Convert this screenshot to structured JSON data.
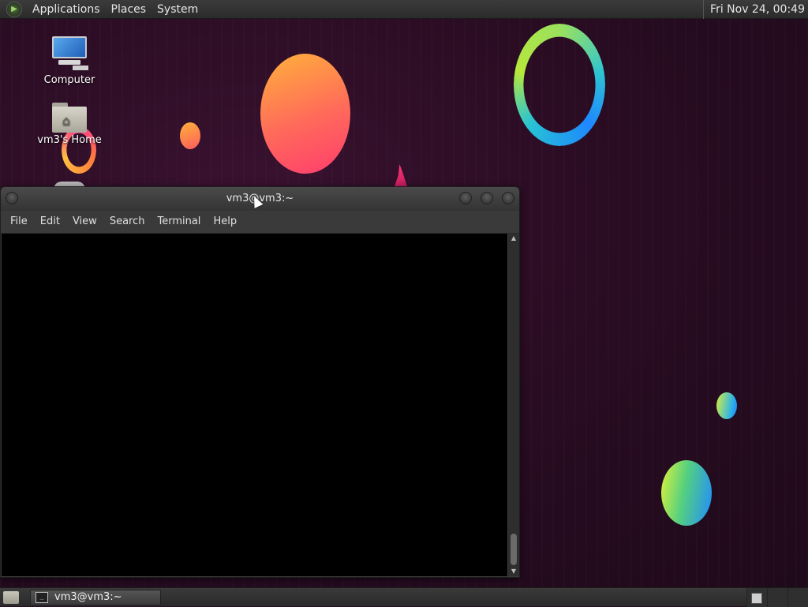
{
  "top_panel": {
    "menus": [
      "Applications",
      "Places",
      "System"
    ],
    "clock": "Fri Nov 24, 00:49"
  },
  "desktop": {
    "icons": [
      {
        "label": "Computer",
        "icon": "computer-icon"
      },
      {
        "label": "vm3's Home",
        "icon": "home-folder-icon"
      }
    ]
  },
  "terminal": {
    "title": "vm3@vm3:~",
    "menu": [
      "File",
      "Edit",
      "View",
      "Search",
      "Terminal",
      "Help"
    ]
  },
  "bottom_panel": {
    "tasks": [
      {
        "label": "vm3@vm3:~",
        "icon": "terminal-icon"
      }
    ]
  }
}
